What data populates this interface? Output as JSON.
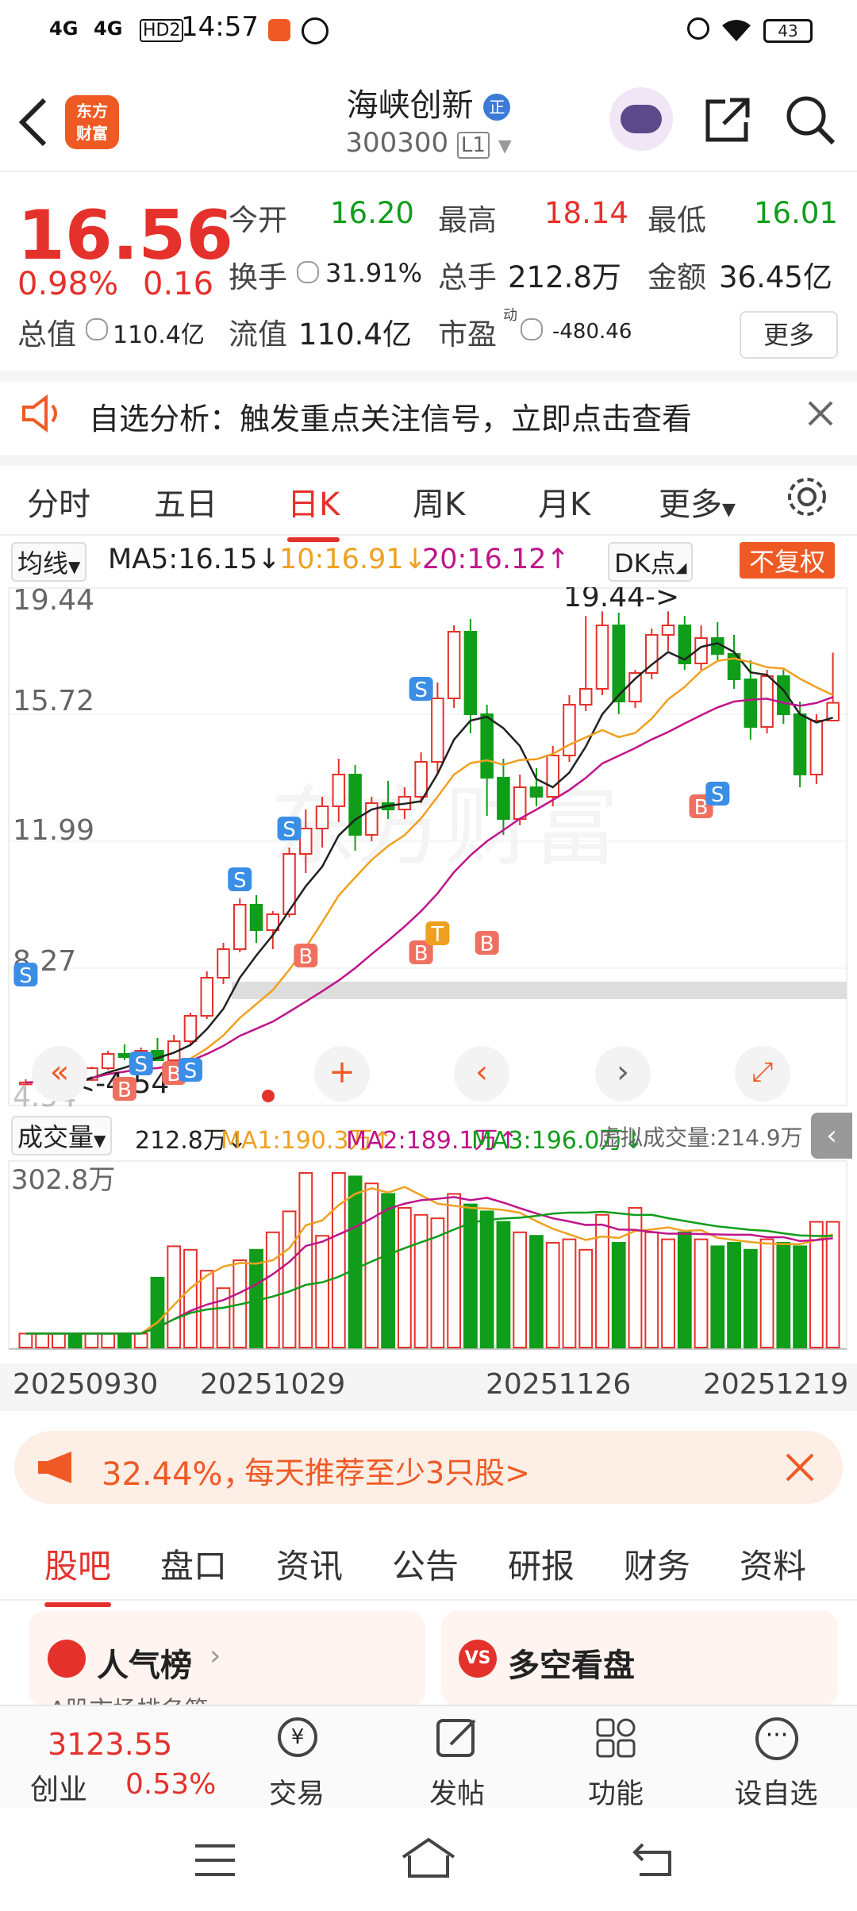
{
  "status": {
    "signal1": "4G",
    "signal2": "4G",
    "hd": "HD2",
    "time": "14:57",
    "battery": "43"
  },
  "header": {
    "logo_line1": "东方",
    "logo_line2": "财富",
    "name": "海峡创新",
    "name_badge": "正",
    "code": "300300",
    "code_level": "L1"
  },
  "quote": {
    "price": "16.56",
    "change_pct": "0.98%",
    "change": "0.16",
    "open_label": "今开",
    "open": "16.20",
    "high_label": "最高",
    "high": "18.14",
    "low_label": "最低",
    "low": "16.01",
    "turnover_label": "换手",
    "turnover": "31.91%",
    "volume_label": "总手",
    "volume": "212.8万",
    "amount_label": "金额",
    "amount": "36.45亿",
    "mktcap_label": "总值",
    "mktcap": "110.4亿",
    "float_label": "流值",
    "float_cap": "110.4亿",
    "pe_label": "市盈",
    "pe_super": "动",
    "pe": "-480.46",
    "more": "更多"
  },
  "notice": {
    "text": "自选分析：触发重点关注信号，立即点击查看"
  },
  "ktabs": [
    "分时",
    "五日",
    "日K",
    "周K",
    "月K",
    "更多"
  ],
  "ma": {
    "label": "均线",
    "ma5": "MA5:16.15",
    "ma10": "10:16.91",
    "ma20": "20:16.12",
    "dk": "DK点",
    "fq": "不复权"
  },
  "chart_axis": {
    "y1": "19.44",
    "y2": "15.72",
    "y3": "11.99",
    "y4": "8.27",
    "hi_label": "19.44->",
    "lo_label": "<-4.54",
    "lo_partial": "4.54"
  },
  "vol": {
    "label": "成交量",
    "vol": "212.8万",
    "ma1": "MA1:190.3万",
    "ma2": "MA2:189.1万",
    "ma3": "MA3:196.0万",
    "virtual": "虚拟成交量:214.9万",
    "ymax": "302.8万"
  },
  "dates": [
    "20250930",
    "20251029",
    "20251126",
    "20251219"
  ],
  "banner": {
    "prefix": "32.44%，",
    "text": "每天推荐至少3只股>"
  },
  "stabs": [
    "股吧",
    "盘口",
    "资讯",
    "公告",
    "研报",
    "财务",
    "资料"
  ],
  "cards": {
    "left": "人气榜",
    "left_sub": "A股市场排名第",
    "right": "多空看盘"
  },
  "bottom": {
    "index_value": "3123.55",
    "index_name": "创业",
    "index_change": "0.53%",
    "trade": "交易",
    "post": "发帖",
    "func": "功能",
    "fav": "设自选"
  },
  "colors": {
    "up": "#e5312b",
    "down": "#0f9d1a",
    "accent": "#ef5a24"
  },
  "chart_data": {
    "type": "candlestick",
    "y_ticks": [
      19.44,
      15.72,
      11.99,
      8.27
    ],
    "candles": [
      [
        4.54,
        4.7,
        4.54,
        4.6
      ],
      [
        4.6,
        4.7,
        4.55,
        4.65
      ],
      [
        4.65,
        4.75,
        4.6,
        4.7
      ],
      [
        4.7,
        4.8,
        4.62,
        4.68
      ],
      [
        4.68,
        5.1,
        4.65,
        5.05
      ],
      [
        5.05,
        5.6,
        5.0,
        5.5
      ],
      [
        5.5,
        5.8,
        5.3,
        5.4
      ],
      [
        5.4,
        5.7,
        5.2,
        5.6
      ],
      [
        5.6,
        6.0,
        5.4,
        5.3
      ],
      [
        5.3,
        6.1,
        5.2,
        5.9
      ],
      [
        5.9,
        6.8,
        5.8,
        6.7
      ],
      [
        6.7,
        8.1,
        6.6,
        7.9
      ],
      [
        7.9,
        9.0,
        7.7,
        8.8
      ],
      [
        8.8,
        10.4,
        8.7,
        10.2
      ],
      [
        10.2,
        10.5,
        9.0,
        9.4
      ],
      [
        9.4,
        10.0,
        8.8,
        9.9
      ],
      [
        9.9,
        12.0,
        9.8,
        11.8
      ],
      [
        11.8,
        13.2,
        11.2,
        12.6
      ],
      [
        12.6,
        13.6,
        12.0,
        13.3
      ],
      [
        13.3,
        14.8,
        12.8,
        14.3
      ],
      [
        14.3,
        14.6,
        11.9,
        12.4
      ],
      [
        12.4,
        13.6,
        12.2,
        13.4
      ],
      [
        13.4,
        14.1,
        12.9,
        13.2
      ],
      [
        13.2,
        13.9,
        12.9,
        13.6
      ],
      [
        13.6,
        15.0,
        13.4,
        14.7
      ],
      [
        14.7,
        17.2,
        14.3,
        16.7
      ],
      [
        16.7,
        19.0,
        16.4,
        18.8
      ],
      [
        18.8,
        19.2,
        15.6,
        16.2
      ],
      [
        16.2,
        16.5,
        13.0,
        14.2
      ],
      [
        14.2,
        14.8,
        12.4,
        12.9
      ],
      [
        12.9,
        14.3,
        12.7,
        13.9
      ],
      [
        13.9,
        14.5,
        13.3,
        13.6
      ],
      [
        13.6,
        15.2,
        13.3,
        14.9
      ],
      [
        14.9,
        16.8,
        14.7,
        16.5
      ],
      [
        16.5,
        19.3,
        16.3,
        17.0
      ],
      [
        17.0,
        19.44,
        16.8,
        19.0
      ],
      [
        19.0,
        19.4,
        16.2,
        16.6
      ],
      [
        16.6,
        17.6,
        16.4,
        17.5
      ],
      [
        17.5,
        18.9,
        17.3,
        18.7
      ],
      [
        18.7,
        19.44,
        18.2,
        19.0
      ],
      [
        19.0,
        19.3,
        17.6,
        17.8
      ],
      [
        17.8,
        19.0,
        17.6,
        18.6
      ],
      [
        18.6,
        19.1,
        17.9,
        18.1
      ],
      [
        18.1,
        18.7,
        17.0,
        17.3
      ],
      [
        17.3,
        17.9,
        15.4,
        15.8
      ],
      [
        15.8,
        17.6,
        15.6,
        17.4
      ],
      [
        17.4,
        17.6,
        15.9,
        16.2
      ],
      [
        16.2,
        16.6,
        13.9,
        14.3
      ],
      [
        14.3,
        16.2,
        14.0,
        16.0
      ],
      [
        16.0,
        18.14,
        16.01,
        16.56
      ]
    ]
  }
}
